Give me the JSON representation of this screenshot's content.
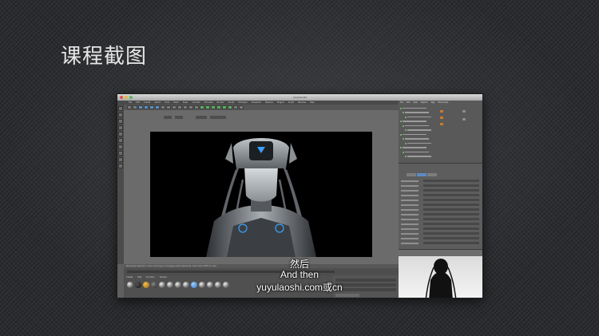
{
  "slide": {
    "title": "课程截图"
  },
  "app": {
    "window_title": "Cinema 4D",
    "traffic_colors": [
      "#e5534b",
      "#e6b43c",
      "#5fb955"
    ],
    "menu": [
      "File",
      "Edit",
      "Create",
      "Select",
      "Tools",
      "Mesh",
      "Snap",
      "Animate",
      "Simulate",
      "Render",
      "Sculpt",
      "MoGraph",
      "Character",
      "Pipeline",
      "Plugins",
      "Script",
      "Window",
      "Help"
    ],
    "object_manager_tabs": [
      "File",
      "Edit",
      "View",
      "Objects",
      "Tags",
      "Bookmarks"
    ],
    "material_tabs": [
      "Create",
      "Edit",
      "Function",
      "Texture"
    ],
    "status_text": "Rectangle Selection: Click and drag to rectangle-select elements. Hold down SHIFT to add"
  },
  "subtitles": {
    "line_cn": "然后",
    "line_en": "And then",
    "watermark": "yuyulaoshi.com或cn"
  },
  "colors": {
    "accent_blue": "#5a8fc6",
    "accent_green": "#58b05e",
    "tag_orange": "#c87b2a",
    "eye_glow": "#3aa0ff"
  }
}
